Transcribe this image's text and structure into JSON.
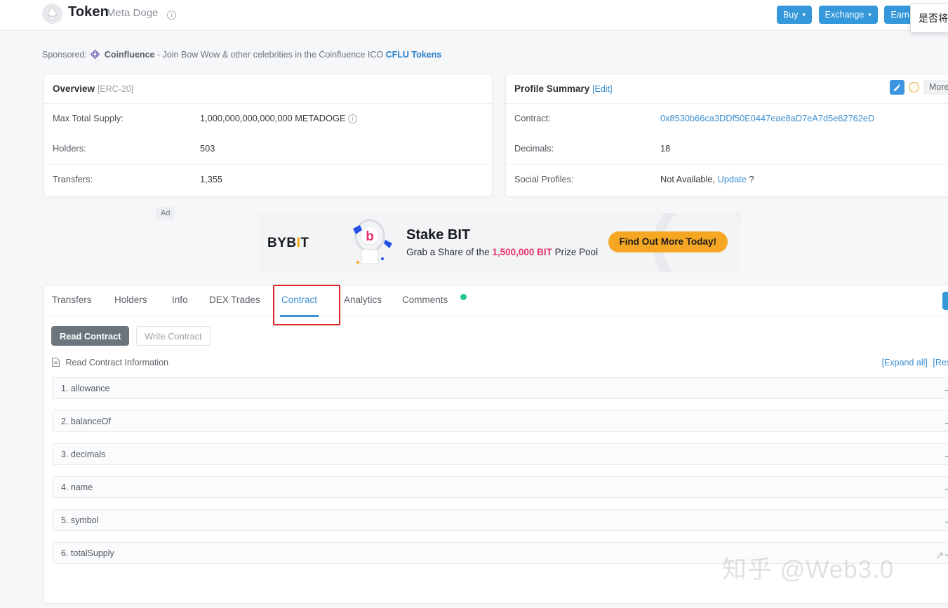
{
  "header": {
    "token_label": "Token",
    "token_name": "Meta Doge",
    "info_icon": "info-icon",
    "buttons": [
      {
        "label": "Buy",
        "caret": "⌄"
      },
      {
        "label": "Exchange",
        "caret": "⌄"
      },
      {
        "label": "Earn",
        "caret": "⌄"
      }
    ],
    "translate_popup": "是否将"
  },
  "sponsored": {
    "prefix": "Sponsored:",
    "brand": "Coinfluence",
    "text": "- Join Bow Wow & other celebrities in the Coinfluence ICO",
    "link": "CFLU Tokens"
  },
  "overview": {
    "title": "Overview",
    "tag": "[ERC-20]",
    "rows": [
      {
        "key": "Max Total Supply:",
        "value": "1,000,000,000,000,000 METADOGE",
        "has_info": true
      },
      {
        "key": "Holders:",
        "value": "503",
        "has_info": false
      },
      {
        "key": "Transfers:",
        "value": "1,355",
        "has_info": false
      }
    ]
  },
  "profile": {
    "title": "Profile Summary",
    "edit": "[Edit]",
    "tools": {
      "wand": "magic-wand-icon",
      "circle": "coin-circle-icon",
      "more_label": "More",
      "more_caret": "⌄"
    },
    "rows": [
      {
        "key": "Contract:",
        "value": "0x8530b66ca3DDf50E0447eae8aD7eA7d5e62762eD",
        "link": true
      },
      {
        "key": "Decimals:",
        "value": "18",
        "link": false
      },
      {
        "key": "Social Profiles:",
        "value": "Not Available,",
        "update": "Update",
        "suffix": "?",
        "link": false
      }
    ]
  },
  "ad": {
    "label": "Ad",
    "brand_a": "BYB",
    "brand_i": "I",
    "brand_b": "T",
    "headline": "Stake BIT",
    "sub_pre": "Grab a Share of the ",
    "sub_amount": "1,500,000 BIT",
    "sub_post": " Prize Pool",
    "cta": "Find Out More Today!"
  },
  "tabs": [
    {
      "label": "Transfers",
      "active": false
    },
    {
      "label": "Holders",
      "active": false
    },
    {
      "label": "Info",
      "active": false
    },
    {
      "label": "DEX Trades",
      "active": false
    },
    {
      "label": "Contract",
      "active": true
    },
    {
      "label": "Analytics",
      "active": false
    },
    {
      "label": "Comments",
      "active": false,
      "badge": "green-dot"
    }
  ],
  "contract": {
    "read_button": "Read Contract",
    "write_button": "Write Contract",
    "section_title": "Read Contract Information",
    "expand_all": "[Expand all]",
    "reset": "[Reset]",
    "arrow_glyph": "→",
    "functions": [
      {
        "label": "1. allowance"
      },
      {
        "label": "2. balanceOf"
      },
      {
        "label": "3. decimals"
      },
      {
        "label": "4. name"
      },
      {
        "label": "5. symbol"
      },
      {
        "label": "6. totalSupply"
      }
    ]
  },
  "search": {
    "icon": "search-icon"
  },
  "watermark": {
    "text": "知乎 @Web3.0",
    "arrow": "↗"
  },
  "colors": {
    "accent_blue": "#3498db",
    "link_blue": "#3b8ed0",
    "annotation_red": "#e0252a",
    "badge_green": "#23c98b",
    "ad_orange": "#f5a623"
  }
}
